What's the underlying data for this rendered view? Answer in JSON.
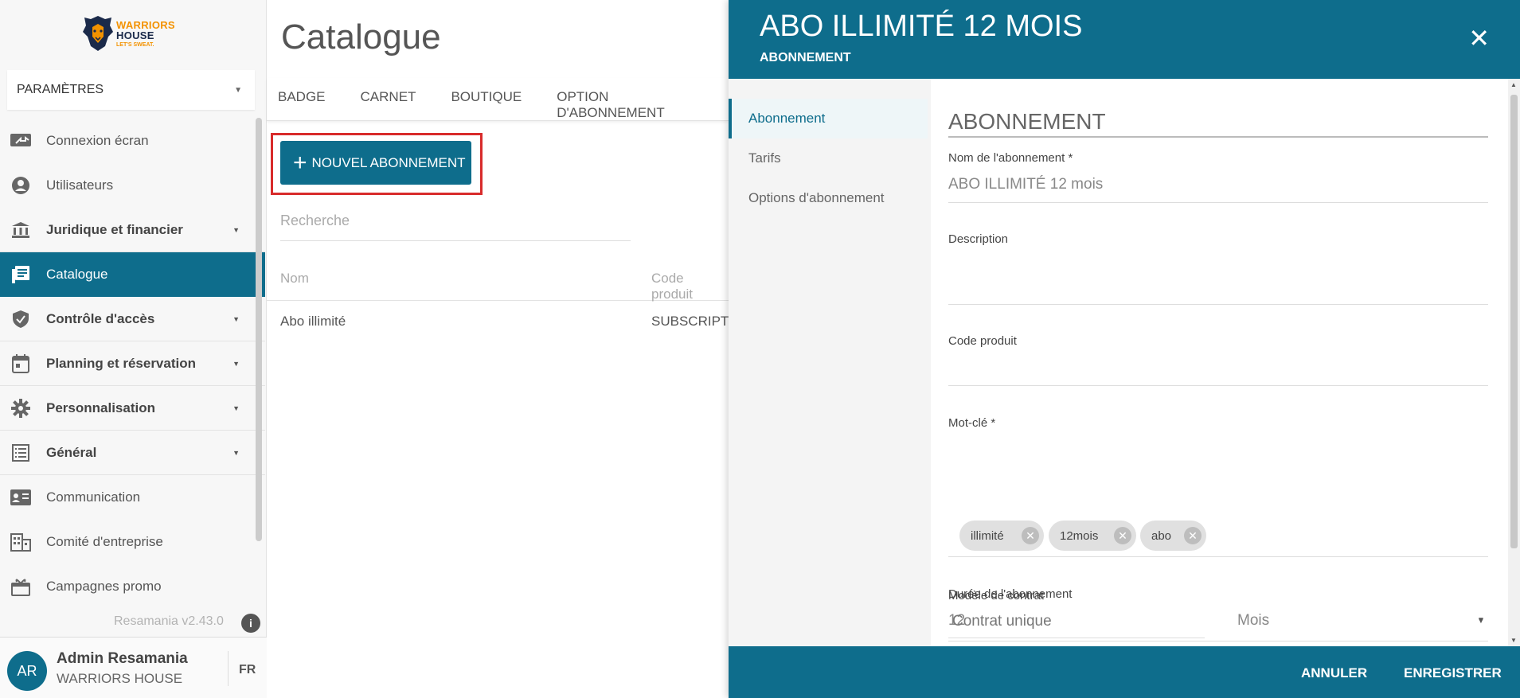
{
  "brand": {
    "line1": "WARRIORS",
    "line2": "HOUSE",
    "tagline": "LET'S SWEAT."
  },
  "sidebar": {
    "section_select": "PARAMÈTRES",
    "items": [
      {
        "label": "Connexion écran",
        "icon": "screen-share-icon"
      },
      {
        "label": "Utilisateurs",
        "icon": "user-icon"
      },
      {
        "label": "Juridique et financier",
        "icon": "bank-icon"
      },
      {
        "label": "Catalogue",
        "icon": "catalog-icon"
      },
      {
        "label": "Contrôle d'accès",
        "icon": "shield-icon"
      },
      {
        "label": "Planning et réservation",
        "icon": "calendar-icon"
      },
      {
        "label": "Personnalisation",
        "icon": "gear-icon"
      },
      {
        "label": "Général",
        "icon": "list-icon"
      },
      {
        "label": "Communication",
        "icon": "contact-card-icon"
      },
      {
        "label": "Comité d'entreprise",
        "icon": "building-icon"
      },
      {
        "label": "Campagnes promo",
        "icon": "gift-icon"
      }
    ],
    "version": "Resamania v2.43.0",
    "user": {
      "initials": "AR",
      "name": "Admin Resamania",
      "org": "WARRIORS HOUSE"
    },
    "language": "FR"
  },
  "main": {
    "title": "Catalogue",
    "tabs": [
      "BADGE",
      "CARNET",
      "BOUTIQUE",
      "OPTION D'ABONNEMENT"
    ],
    "new_button": "NOUVEL ABONNEMENT",
    "search_placeholder": "Recherche",
    "columns": [
      "Nom",
      "Code produit"
    ],
    "rows": [
      {
        "name": "Abo illimité",
        "code": "SUBSCRIPTI"
      }
    ]
  },
  "drawer": {
    "title": "ABO ILLIMITÉ 12 MOIS",
    "subtitle": "ABONNEMENT",
    "side_tabs": [
      "Abonnement",
      "Tarifs",
      "Options d'abonnement"
    ],
    "section_title": "ABONNEMENT",
    "fields": {
      "name_label": "Nom de l'abonnement *",
      "name_value": "ABO ILLIMITÉ 12 mois",
      "description_label": "Description",
      "code_label": "Code produit",
      "keyword_label": "Mot-clé *",
      "keywords": [
        "illimité",
        "12mois",
        "abo"
      ],
      "duration_label": "Durée de l'abonnement",
      "duration_value": "12",
      "duration_unit": "Mois",
      "contract_label": "Modèle de contrat",
      "contract_value": "Contrat unique"
    },
    "cancel": "ANNULER",
    "save": "ENREGISTRER"
  },
  "colors": {
    "primary": "#0e6d8c",
    "highlight": "#d82b2b",
    "brand_orange": "#f39200"
  }
}
